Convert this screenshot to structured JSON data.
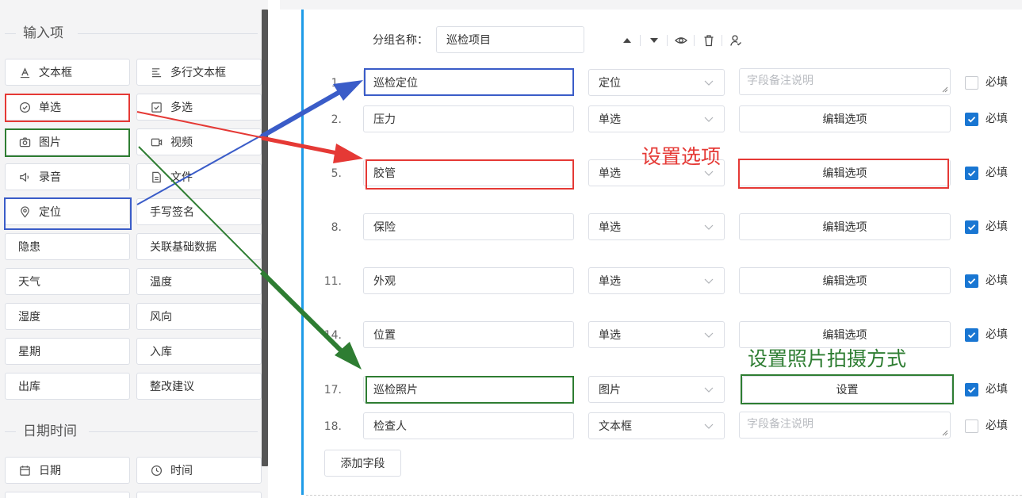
{
  "palette": {
    "input_section_title": "输入项",
    "datetime_section_title": "日期时间",
    "input_items": [
      {
        "label": "文本框",
        "icon": "text-a-icon"
      },
      {
        "label": "多行文本框",
        "icon": "multiline-text-icon"
      },
      {
        "label": "单选",
        "icon": "radio-circle-check-icon"
      },
      {
        "label": "多选",
        "icon": "checkbox-icon"
      },
      {
        "label": "图片",
        "icon": "camera-icon"
      },
      {
        "label": "视频",
        "icon": "video-icon"
      },
      {
        "label": "录音",
        "icon": "speaker-icon"
      },
      {
        "label": "文件",
        "icon": "file-icon"
      },
      {
        "label": "定位",
        "icon": "location-pin-icon"
      },
      {
        "label": "手写签名",
        "icon": ""
      },
      {
        "label": "隐患",
        "icon": ""
      },
      {
        "label": "关联基础数据",
        "icon": ""
      },
      {
        "label": "天气",
        "icon": ""
      },
      {
        "label": "温度",
        "icon": ""
      },
      {
        "label": "湿度",
        "icon": ""
      },
      {
        "label": "风向",
        "icon": ""
      },
      {
        "label": "星期",
        "icon": ""
      },
      {
        "label": "入库",
        "icon": ""
      },
      {
        "label": "出库",
        "icon": ""
      },
      {
        "label": "整改建议",
        "icon": ""
      }
    ],
    "datetime_items": [
      {
        "label": "日期",
        "icon": "calendar-icon"
      },
      {
        "label": "时间",
        "icon": "clock-icon"
      }
    ]
  },
  "group": {
    "name_label": "分组名称：",
    "name_value": "巡检项目",
    "tools": [
      "move-up-icon",
      "move-down-icon",
      "eye-icon",
      "trash-icon",
      "person-icon"
    ]
  },
  "fields": [
    {
      "num": "1.",
      "name": "巡检定位",
      "type": "定位",
      "action_kind": "textarea",
      "action": "字段备注说明",
      "required_label": "必填",
      "required": false
    },
    {
      "num": "2.",
      "name": "压力",
      "type": "单选",
      "action_kind": "button",
      "action": "编辑选项",
      "required_label": "必填",
      "required": true
    },
    {
      "num": "5.",
      "name": "胶管",
      "type": "单选",
      "action_kind": "button",
      "action": "编辑选项",
      "required_label": "必填",
      "required": true
    },
    {
      "num": "8.",
      "name": "保险",
      "type": "单选",
      "action_kind": "button",
      "action": "编辑选项",
      "required_label": "必填",
      "required": true
    },
    {
      "num": "11.",
      "name": "外观",
      "type": "单选",
      "action_kind": "button",
      "action": "编辑选项",
      "required_label": "必填",
      "required": true
    },
    {
      "num": "14.",
      "name": "位置",
      "type": "单选",
      "action_kind": "button",
      "action": "编辑选项",
      "required_label": "必填",
      "required": true
    },
    {
      "num": "17.",
      "name": "巡检照片",
      "type": "图片",
      "action_kind": "button",
      "action": "设置",
      "required_label": "必填",
      "required": true
    },
    {
      "num": "18.",
      "name": "检查人",
      "type": "文本框",
      "action_kind": "textarea",
      "action": "字段备注说明",
      "required_label": "必填",
      "required": false
    }
  ],
  "add_field_label": "添加字段",
  "annotations": {
    "set_options": "设置选项",
    "set_photo_mode": "设置照片拍摄方式"
  },
  "colors": {
    "accent_blue": "#1e9ce8",
    "checkbox_blue": "#1976d2",
    "annotation_red": "#e53935",
    "annotation_green": "#2e7d32",
    "annotation_blue": "#3a5cc8"
  }
}
